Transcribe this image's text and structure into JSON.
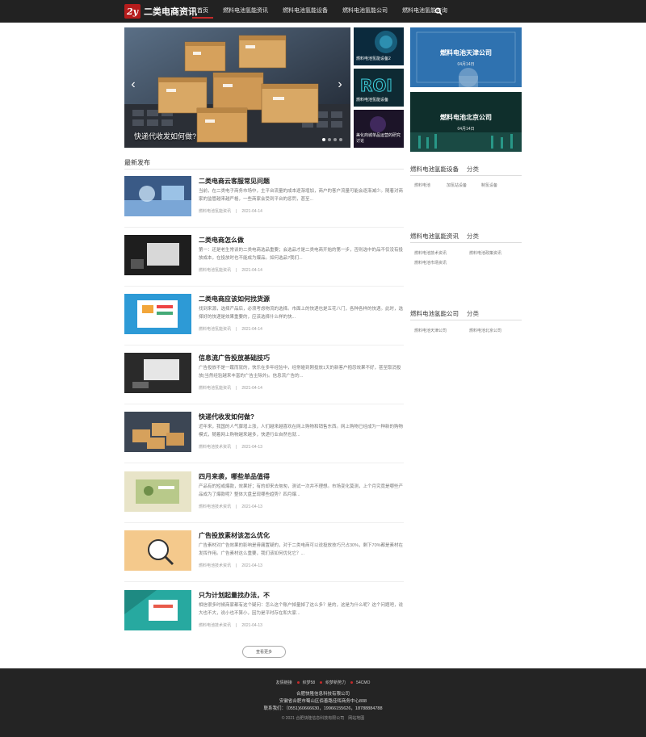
{
  "header": {
    "logo_mark": "2y",
    "site_name": "二类电商资讯",
    "nav": [
      "首页",
      "燃料电池氢能资讯",
      "燃料电池氢能设备",
      "燃料电池氢能公司",
      "燃料电池氢能咨询"
    ]
  },
  "hero": {
    "caption": "快递代收发如何做?",
    "prev": "‹",
    "next": "›",
    "thumbs": [
      {
        "label": "燃料电池氢能设备2"
      },
      {
        "label": "燃料电池氢能设备"
      },
      {
        "label": "美化商城单品运营的研究讨论"
      }
    ]
  },
  "features": [
    {
      "title": "燃料电池天津公司",
      "date": "04月14日"
    },
    {
      "title": "燃料电池北京公司",
      "date": "04月14日"
    }
  ],
  "latest": {
    "title": "最新发布",
    "articles": [
      {
        "title": "二类电商云客服常见问题",
        "summary": "当前，在二类电子商务市场中，主平台流量的成本逐渐增加，商户的客户流量可能会逐渐减少。随着对商家的监管越来越严格，一些商家会受到平台的惩罚，甚至...",
        "category": "燃料电池氢能资讯",
        "date": "2021-04-14"
      },
      {
        "title": "二类电商怎么做",
        "summary": "第一：还是老生常谈的二类电商选品重要；会选品才是二类电商开始的第一步，否则选中的品不仅没有投放成本，在投放时也不能成为爆品。如何选品?我们...",
        "category": "燃料电池氢能资讯",
        "date": "2021-04-14"
      },
      {
        "title": "二类电商应该如何找货源",
        "summary": "找到来源，选择产品后，必须考虑物流的选择。市面上的快递也是五花八门，各种各样的快递。此时，选择好的快递是效果重要的，应该选择什么样的快...",
        "category": "燃料电池氢能资讯",
        "date": "2021-04-14"
      },
      {
        "title": "信息流广告投放基础技巧",
        "summary": "广告投放不是一蹴而就的，快乐在多年经验中，经常碰到刚投放1天的新客户抱怨效果不好，甚至取消投放(当然经验越来丰富的广告主除外)。信息流广告的...",
        "category": "燃料电池氢能资讯",
        "date": "2021-04-14"
      },
      {
        "title": "快递代收发如何做?",
        "summary": "近年来，我国的人气骤增上涨，人们越来越喜欢在网上购物和销售东西。网上购物已经成为一种新的购物模式，随着网上购物越来越多，快递行业自然也就...",
        "category": "燃料电池技术资讯",
        "date": "2021-04-13"
      },
      {
        "title": "四月来袭，哪些单品值得",
        "summary": "产品有的短或爆款，效果好；有的却来去匆匆，测试一次并不理想。市场变化莫测，上个月究竟是哪些产品成为了爆款呢？整体大盘呈现哪些趋势？四月爆...",
        "category": "燃料电池技术资讯",
        "date": "2021-04-13"
      },
      {
        "title": "广告投放素材该怎么优化",
        "summary": "广告素材对广告效果的影响是毋庸置疑的，对于二类电商可以说投放技巧只占30%，剩下70%都是素材在发挥作用。广告素材这么重要，我们该如何优化它？...",
        "category": "燃料电池技术资讯",
        "date": "2021-04-13"
      },
      {
        "title": "只为计划起量找办法，不",
        "summary": "相信很多时候商家都有这个疑问：怎么这个账户掉量掉了这么多？是的，这是为什么呢？这个问题吧，说大也不大，说小也不算小，因为是平时存在和大家...",
        "category": "燃料电池技术资讯",
        "date": "2021-04-13"
      }
    ],
    "more_label": "查看更多"
  },
  "sidebar": {
    "sections": [
      {
        "title": "燃料电池氢能设备",
        "sub": "分类",
        "links": [
          "燃料电池",
          "加氢站设备",
          "制氢设备"
        ]
      },
      {
        "title": "燃料电池氢能资讯",
        "sub": "分类",
        "links": [
          "燃料电池技术资讯",
          "燃料电池政策资讯",
          "燃料电池市场资讯"
        ]
      },
      {
        "title": "燃料电池氢能公司",
        "sub": "分类",
        "links": [
          "燃料电池天津公司",
          "燃料电池北京公司"
        ]
      }
    ]
  },
  "footer": {
    "friend_label": "友情链接",
    "friends": [
      "织梦58",
      "织梦新势力",
      "54CMO"
    ],
    "company": "合肥快隆信息科技有限公司",
    "address": "安徽省合肥市蜀山区佰善路佳晖商务中心808",
    "contact": "联系我们：（0551)60666630，19966155626，18788884788",
    "copyright": "© 2021 合肥快隆信息科技有限公司　网站地图"
  },
  "colors": {
    "accent": "#c62a2a",
    "header_bg": "#222222",
    "footer_bg": "#242424"
  }
}
